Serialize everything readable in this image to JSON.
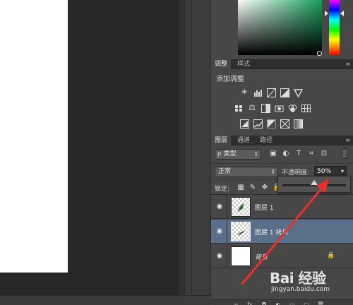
{
  "color_panel": {
    "field_tint": "#16a05a"
  },
  "adjust_panel": {
    "tabs": [
      "调整",
      "样式"
    ],
    "title": "添加调整",
    "row1_icons": [
      "brightness-icon",
      "levels-icon",
      "curves-icon",
      "exposure-icon",
      "vibrance-triangle-icon"
    ],
    "row2_icons": [
      "hue-saturation-icon",
      "color-balance-icon",
      "black-white-icon",
      "photo-filter-icon",
      "channel-mixer-icon",
      "color-lookup-icon"
    ],
    "row3_icons": [
      "invert-icon",
      "posterize-icon",
      "threshold-icon",
      "selective-color-icon",
      "gradient-map-icon"
    ]
  },
  "layers_panel": {
    "tabs": [
      "图层",
      "通道",
      "路径"
    ],
    "filter_label": "ρ 类型",
    "blend_mode": "正常",
    "opacity_label": "不透明度:",
    "opacity_value": "50%",
    "opacity_fraction": 0.5,
    "lock_label": "锁定:",
    "layers": [
      {
        "name": "图层 1",
        "selected": false,
        "visible": true,
        "locked": false
      },
      {
        "name": "图层 1 拷贝",
        "selected": true,
        "visible": true,
        "locked": false
      },
      {
        "name": "背景",
        "selected": false,
        "visible": true,
        "locked": true
      }
    ]
  },
  "annotation": {
    "color": "#e8312a"
  },
  "watermark": {
    "brand": "Bai 经验",
    "url": "jingyan.baidu.com"
  }
}
